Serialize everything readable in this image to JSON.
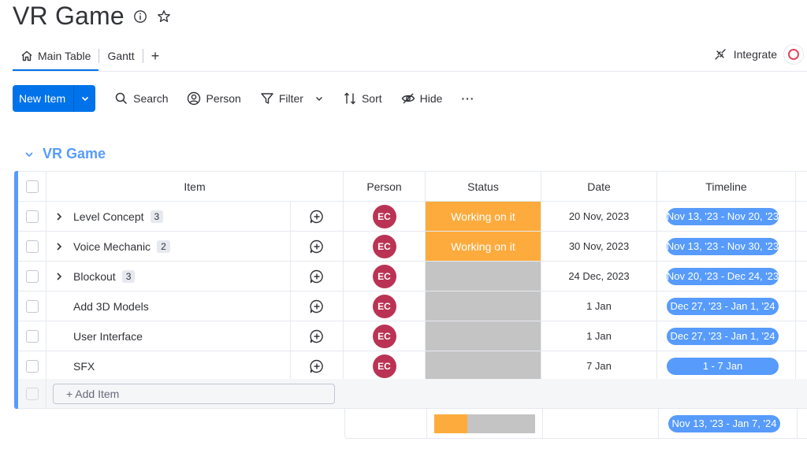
{
  "board": {
    "title": "VR Game",
    "info_icon": "info-icon",
    "favorite_icon": "star-icon"
  },
  "tabs": [
    {
      "label": "Main Table",
      "icon": "home-icon",
      "active": true
    },
    {
      "label": "Gantt",
      "active": false
    }
  ],
  "tabs_add": "+",
  "integrate": {
    "label": "Integrate",
    "icon": "integrate-icon"
  },
  "toolbar": {
    "new_item_label": "New Item",
    "search_label": "Search",
    "person_label": "Person",
    "filter_label": "Filter",
    "sort_label": "Sort",
    "hide_label": "Hide",
    "more_label": "···"
  },
  "group": {
    "title": "VR Game",
    "color": "#579bfc",
    "columns": {
      "item": "Item",
      "person": "Person",
      "status": "Status",
      "date": "Date",
      "timeline": "Timeline"
    },
    "rows": [
      {
        "name": "Level Concept",
        "subitems": "3",
        "person": "EC",
        "status": "Working on it",
        "date": "20 Nov, 2023",
        "timeline": "Nov 13, '23 - Nov 20, '23"
      },
      {
        "name": "Voice Mechanic",
        "subitems": "2",
        "person": "EC",
        "status": "Working on it",
        "date": "30 Nov, 2023",
        "timeline": "Nov 13, '23 - Nov 30, '23"
      },
      {
        "name": "Blockout",
        "subitems": "3",
        "person": "EC",
        "status": "",
        "date": "24 Dec, 2023",
        "timeline": "Nov 20, '23 - Dec 24, '23"
      },
      {
        "name": "Add 3D Models",
        "subitems": "",
        "person": "EC",
        "status": "",
        "date": "1 Jan",
        "timeline": "Dec 27, '23 - Jan 1, '24"
      },
      {
        "name": "User Interface",
        "subitems": "",
        "person": "EC",
        "status": "",
        "date": "1 Jan",
        "timeline": "Dec 27, '23 - Jan 1, '24"
      },
      {
        "name": "SFX",
        "subitems": "",
        "person": "EC",
        "status": "",
        "date": "7 Jan",
        "timeline": "1 - 7 Jan"
      }
    ],
    "add_item_label": "+ Add Item",
    "summary": {
      "status_working_fraction": 0.33,
      "timeline": "Nov 13, '23 - Jan 7, '24"
    }
  },
  "colors": {
    "accent": "#0073ea",
    "status_working": "#fdab3d",
    "status_empty": "#c4c4c4",
    "avatar": "#bb3354",
    "timeline_pill": "#579bfc"
  }
}
